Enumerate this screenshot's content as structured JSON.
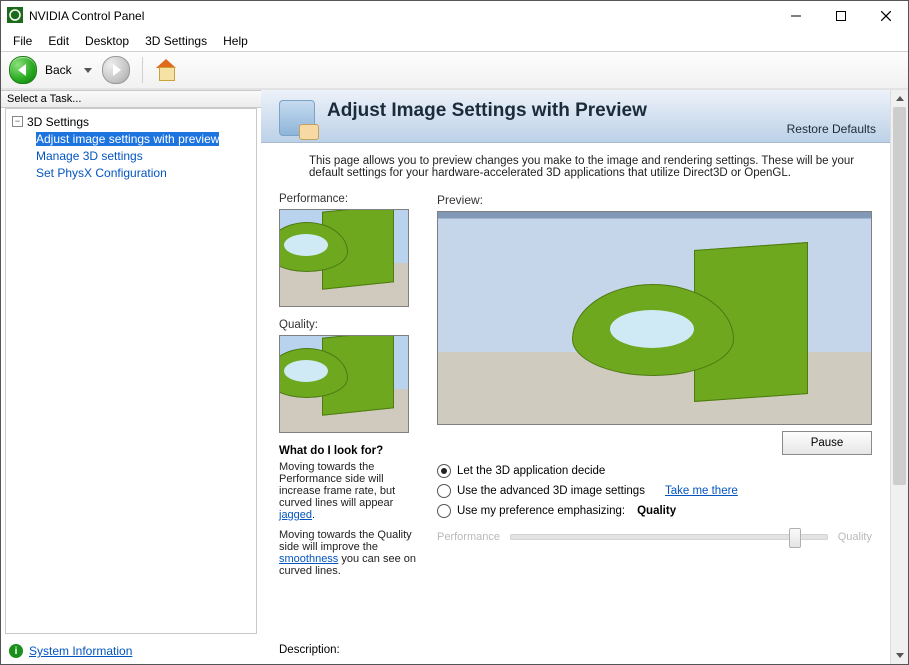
{
  "titlebar": {
    "title": "NVIDIA Control Panel"
  },
  "menu": {
    "file": "File",
    "edit": "Edit",
    "desktop": "Desktop",
    "settings3d": "3D Settings",
    "help": "Help"
  },
  "toolbar": {
    "back": "Back"
  },
  "taskpane": {
    "header": "Select a Task...",
    "root": "3D Settings",
    "items": [
      "Adjust image settings with preview",
      "Manage 3D settings",
      "Set PhysX Configuration"
    ]
  },
  "footer": {
    "sysinfo": "System Information"
  },
  "page": {
    "title": "Adjust Image Settings with Preview",
    "restore": "Restore Defaults",
    "intro": "This page allows you to preview changes you make to the image and rendering settings. These will be your default settings for your hardware-accelerated 3D applications that utilize Direct3D or OpenGL.",
    "perf_label": "Performance:",
    "qual_label": "Quality:",
    "preview_label": "Preview:",
    "what_heading": "What do I look for?",
    "what_p1_a": "Moving towards the Performance side will increase frame rate, but curved lines will appear ",
    "what_p1_link": "jagged",
    "what_p1_b": ".",
    "what_p2_a": "Moving towards the Quality side will improve the ",
    "what_p2_link": "smoothness",
    "what_p2_b": " you can see on curved lines.",
    "pause": "Pause",
    "radio1": "Let the 3D application decide",
    "radio2": "Use the advanced 3D image settings",
    "take_me": "Take me there",
    "radio3": "Use my preference emphasizing:",
    "pref_value": "Quality",
    "slider_left": "Performance",
    "slider_right": "Quality",
    "description_label": "Description:"
  }
}
